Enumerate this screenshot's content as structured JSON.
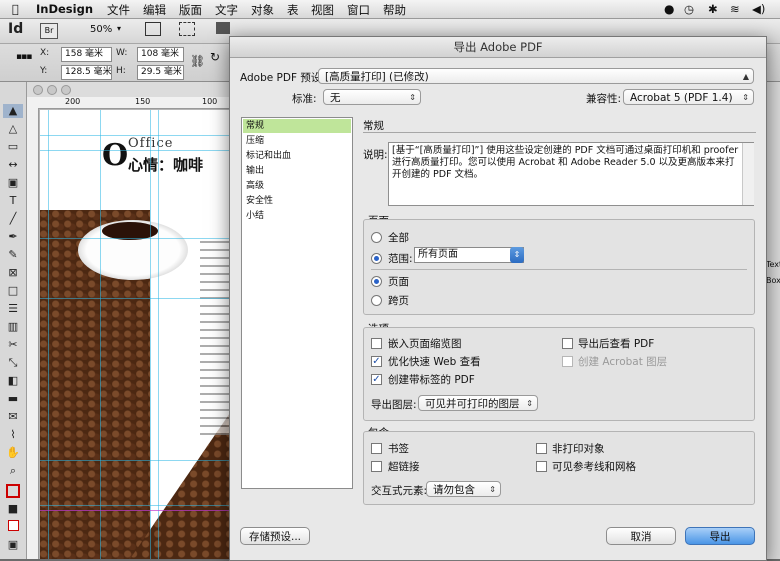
{
  "menubar": {
    "app_name": "InDesign",
    "items": [
      "文件",
      "编辑",
      "版面",
      "文字",
      "对象",
      "表",
      "视图",
      "窗口",
      "帮助"
    ]
  },
  "appbar": {
    "logo": "Id",
    "bridge": "Br",
    "zoom": "50%"
  },
  "control": {
    "x_label": "X:",
    "x_value": "158 毫米",
    "y_label": "Y:",
    "y_value": "128.5 毫米",
    "w_label": "W:",
    "w_value": "108 毫米",
    "h_label": "H:",
    "h_value": "29.5 毫米"
  },
  "ruler": {
    "h_ticks": [
      "200",
      "150",
      "100"
    ]
  },
  "document": {
    "office_word": "Office",
    "headline": "心情：咖啡"
  },
  "dialog": {
    "title": "导出 Adobe PDF",
    "preset_label": "Adobe PDF 预设:",
    "preset_value": "[高质量打印] (已修改)",
    "standard_label": "标准:",
    "standard_value": "无",
    "compat_label": "兼容性:",
    "compat_value": "Acrobat 5 (PDF 1.4)",
    "sidebar": [
      "常规",
      "压缩",
      "标记和出血",
      "输出",
      "高级",
      "安全性",
      "小结"
    ],
    "section_title": "常规",
    "desc_label": "说明:",
    "desc_text": "[基于“[高质量打印]”] 使用这些设定创建的 PDF 文档可通过桌面打印机和 proofer 进行高质量打印。您可以使用 Acrobat 和 Adobe Reader 5.0 以及更高版本来打开创建的 PDF 文档。",
    "pages_group": "页面",
    "all_label": "全部",
    "range_label": "范围:",
    "range_value": "所有页面",
    "pages_label": "页面",
    "spreads_label": "跨页",
    "options_group": "选项",
    "opt_embed_thumbs": "嵌入页面缩览图",
    "opt_optimize_web": "优化快速 Web 查看",
    "opt_tagged_pdf": "创建带标签的 PDF",
    "opt_view_after": "导出后查看 PDF",
    "opt_acrobat_layers": "创建 Acrobat 图层",
    "export_layers_label": "导出图层:",
    "export_layers_value": "可见并可打印的图层",
    "include_group": "包含",
    "inc_bookmarks": "书签",
    "inc_hyperlinks": "超链接",
    "inc_nonprinting": "非打印对象",
    "inc_guides": "可见参考线和网格",
    "interactive_label": "交互式元素:",
    "interactive_value": "请勿包含",
    "save_preset_button": "存储预设...",
    "cancel_button": "取消",
    "export_button": "导出"
  },
  "right_panel": {
    "texts": [
      "Text",
      "Box"
    ]
  },
  "colors": {
    "accent_green": "#bfe59a",
    "primary_blue": "#4a95e6",
    "guide_cyan": "#2fb8e6"
  }
}
